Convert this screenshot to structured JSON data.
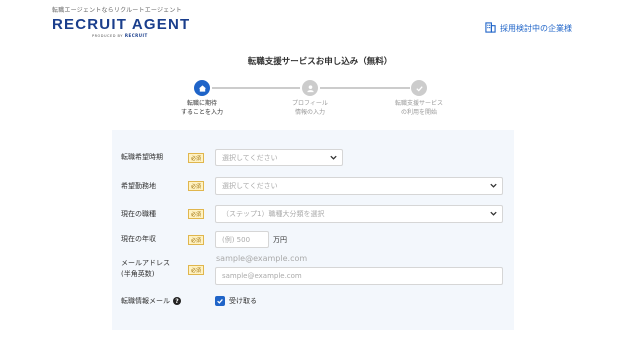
{
  "header": {
    "tagline": "転職エージェントならリクルートエージェント",
    "logo": "RECRUIT AGENT",
    "logo_sub_prefix": "PRODUCED BY",
    "logo_sub_brand": "RECRUIT",
    "company_link": "採用検討中の企業様",
    "company_icon": "building-icon"
  },
  "page_title": "転職支援サービスお申し込み（無料）",
  "steps": [
    {
      "line1": "転職に期待",
      "line2": "することを入力",
      "state": "active",
      "icon": "home-icon"
    },
    {
      "line1": "プロフィール",
      "line2": "情報の入力",
      "state": "inactive",
      "icon": "person-icon"
    },
    {
      "line1": "転職支援サービス",
      "line2": "の利用を開始",
      "state": "inactive",
      "icon": "check-icon"
    }
  ],
  "form": {
    "required_label": "必須",
    "fields": {
      "timing": {
        "label": "転職希望時期",
        "placeholder": "選択してください"
      },
      "location": {
        "label": "希望勤務地",
        "placeholder": "選択してください"
      },
      "job": {
        "label": "現在の職種",
        "placeholder": "（ステップ1）職種大分類を選択"
      },
      "salary": {
        "label": "現在の年収",
        "placeholder": "(例) 500",
        "unit": "万円"
      },
      "email": {
        "label_line1": "メールアドレス",
        "label_line2": "(半角英数)",
        "hint": "sample@example.com",
        "placeholder": "sample@example.com"
      },
      "newsletter": {
        "label": "転職情報メール",
        "checkbox_label": "受け取る",
        "checked": true
      }
    }
  },
  "colors": {
    "accent": "#1f64c8",
    "brand": "#1a3e8c",
    "required_bg": "#fff2c2",
    "form_bg": "#f3f7fc"
  }
}
